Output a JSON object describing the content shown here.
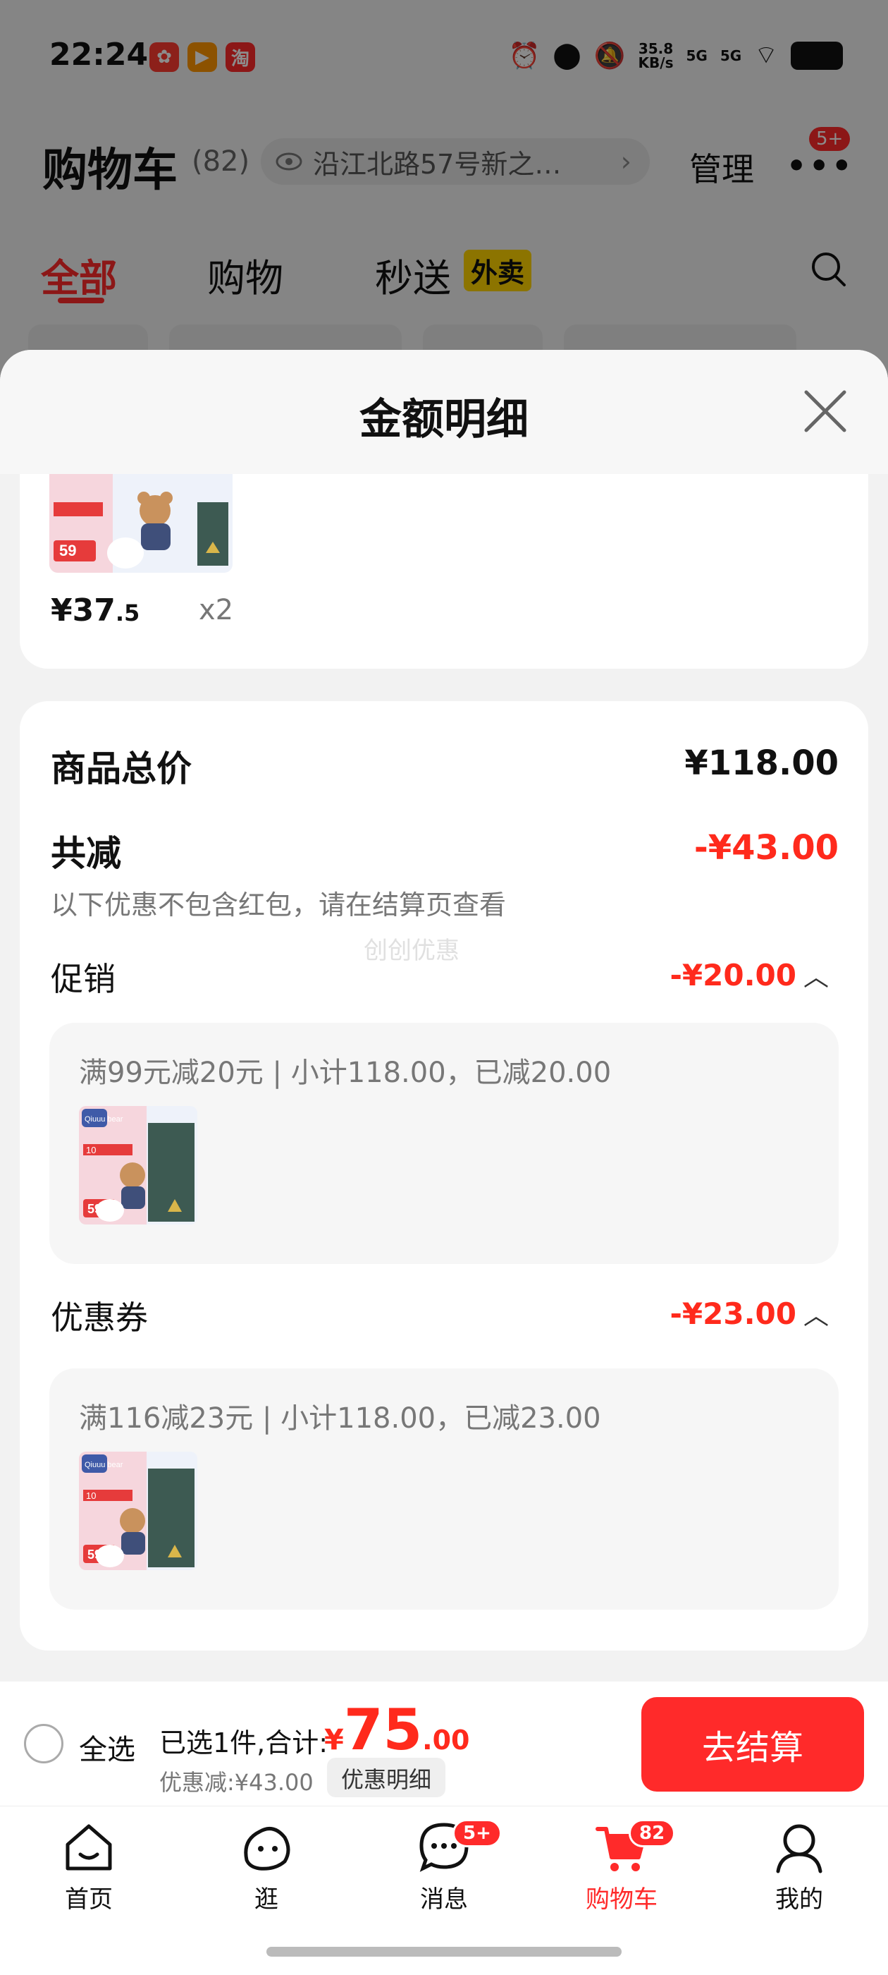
{
  "status_bar": {
    "time": "22:24",
    "net_speed_value": "35.8",
    "net_speed_unit": "KB/s",
    "signal_1": "5G",
    "signal_2": "5G",
    "app_icons": [
      {
        "name": "app-icon-red",
        "color": "#ff3b30",
        "glyph": "✿"
      },
      {
        "name": "app-icon-orange",
        "color": "#ff9500",
        "glyph": "▶"
      },
      {
        "name": "app-icon-taobao",
        "color": "#ff2a2a",
        "glyph": "淘"
      }
    ]
  },
  "cart_header": {
    "title": "购物车",
    "count": "(82)",
    "address": "沿江北路57号新之…",
    "manage": "管理",
    "more_badge": "5+"
  },
  "tabs": {
    "all": "全部",
    "shopping": "购物",
    "express": "秒送",
    "express_badge": "外卖"
  },
  "sheet": {
    "title": "金额明细",
    "top_item": {
      "price_int": "¥37",
      "price_frac": ".5",
      "qty": "x2"
    },
    "subtotal_label": "商品总价",
    "subtotal_value": "¥118.00",
    "reduction_label": "共减",
    "reduction_value": "-¥43.00",
    "note": "以下优惠不包含红包，请在结算页查看",
    "watermark": "创创优惠",
    "promo": {
      "label": "促销",
      "value": "-¥20.00",
      "detail": "满99元减20元 | 小计118.00，已减20.00"
    },
    "coupon": {
      "label": "优惠券",
      "value": "-¥23.00",
      "detail": "满116减23元 | 小计118.00，已减23.00"
    },
    "product_thumb_text": {
      "brand": "Qiuuu bear",
      "price": "59",
      "chip": "10"
    }
  },
  "checkout": {
    "select_all": "全选",
    "selected_info": "已选1件,合计:",
    "total_symbol": "¥",
    "total_int": "75",
    "total_dec": ".00",
    "discount_info": "优惠减:¥43.00",
    "detail_button": "优惠明细",
    "checkout_button": "去结算"
  },
  "bottom_nav": {
    "items": [
      {
        "label": "首页"
      },
      {
        "label": "逛"
      },
      {
        "label": "消息",
        "badge": "5+"
      },
      {
        "label": "购物车",
        "badge": "82"
      },
      {
        "label": "我的"
      }
    ]
  },
  "colors": {
    "accent_red": "#ff2a2a",
    "price_red": "#ff2a1c",
    "badge_yellow": "#ffd400"
  }
}
